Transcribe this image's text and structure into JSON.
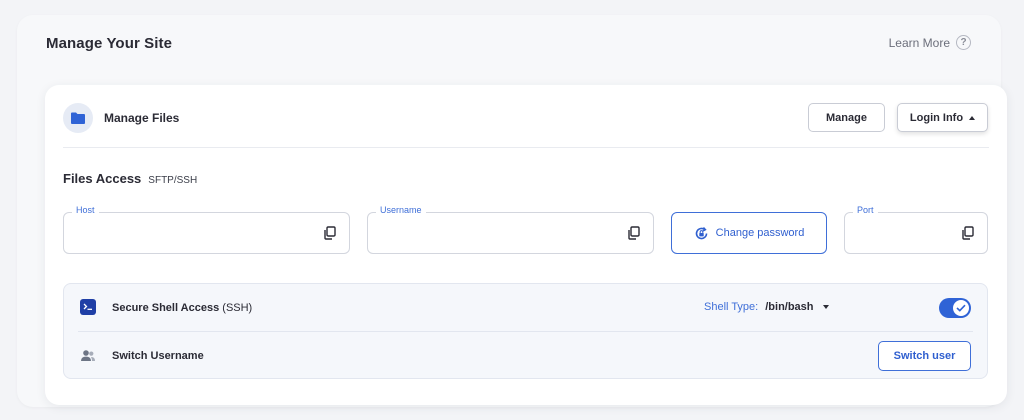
{
  "section": {
    "title": "Manage Your Site",
    "learn_more": "Learn More",
    "help_glyph": "?"
  },
  "card": {
    "title": "Manage Files",
    "manage_button": "Manage",
    "login_info_button": "Login Info"
  },
  "files_access": {
    "title": "Files Access",
    "subtitle": "SFTP/SSH",
    "host": {
      "label": "Host",
      "value": ""
    },
    "username": {
      "label": "Username",
      "value": ""
    },
    "change_password": "Change password",
    "port": {
      "label": "Port",
      "value": ""
    }
  },
  "ssh": {
    "label_bold": "Secure Shell Access",
    "label_rest": " (SSH)",
    "shell_type_label": "Shell Type:",
    "shell_type_value": "/bin/bash",
    "enabled": true
  },
  "switch_user": {
    "label": "Switch Username",
    "button": "Switch user"
  },
  "colors": {
    "accent": "#2f63d6",
    "ssh_icon": "#1f3fa6",
    "page_bg": "#f3f4f7"
  },
  "icons": [
    "help-icon",
    "folder-icon",
    "caret-up-icon",
    "copy-icon",
    "refresh-lock-icon",
    "terminal-icon",
    "caret-down-icon",
    "check-icon",
    "users-icon"
  ]
}
